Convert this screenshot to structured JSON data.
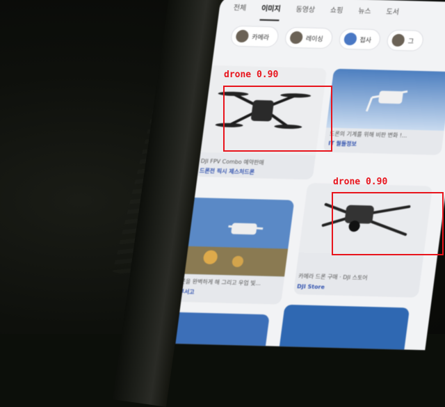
{
  "app": {
    "tabs": [
      "전체",
      "이미지",
      "동영상",
      "쇼핑",
      "뉴스",
      "도서"
    ],
    "active_tab_index": 1
  },
  "chips": [
    {
      "label": "카메라",
      "icon": "camera-thumbnail-icon"
    },
    {
      "label": "레이싱",
      "icon": "racing-thumbnail-icon"
    },
    {
      "label": "접사",
      "icon": "closeup-thumbnail-icon"
    },
    {
      "label": "그",
      "icon": "drone-thumbnail-icon"
    }
  ],
  "results": [
    {
      "caption": "DJI FPV Combo 예약판매",
      "source": "드론전 픽시 제스처드론"
    },
    {
      "caption": "드론의 기계를 위해 비판 변화 !...",
      "source": "IT 월들정보"
    },
    {
      "caption": "드론을 완벽하게 해 그리고 우업 빛...",
      "source": "정부서고"
    },
    {
      "caption": "카메라 드론 구매 · DJI 스토어",
      "source": "DJI Store"
    }
  ],
  "detections": [
    {
      "label": "drone 0.90",
      "class": "drone",
      "score": 0.9
    },
    {
      "label": "drone 0.90",
      "class": "drone",
      "score": 0.9
    }
  ],
  "colors": {
    "bbox": "#e8141c",
    "screen_bg": "#f2f3f5"
  }
}
